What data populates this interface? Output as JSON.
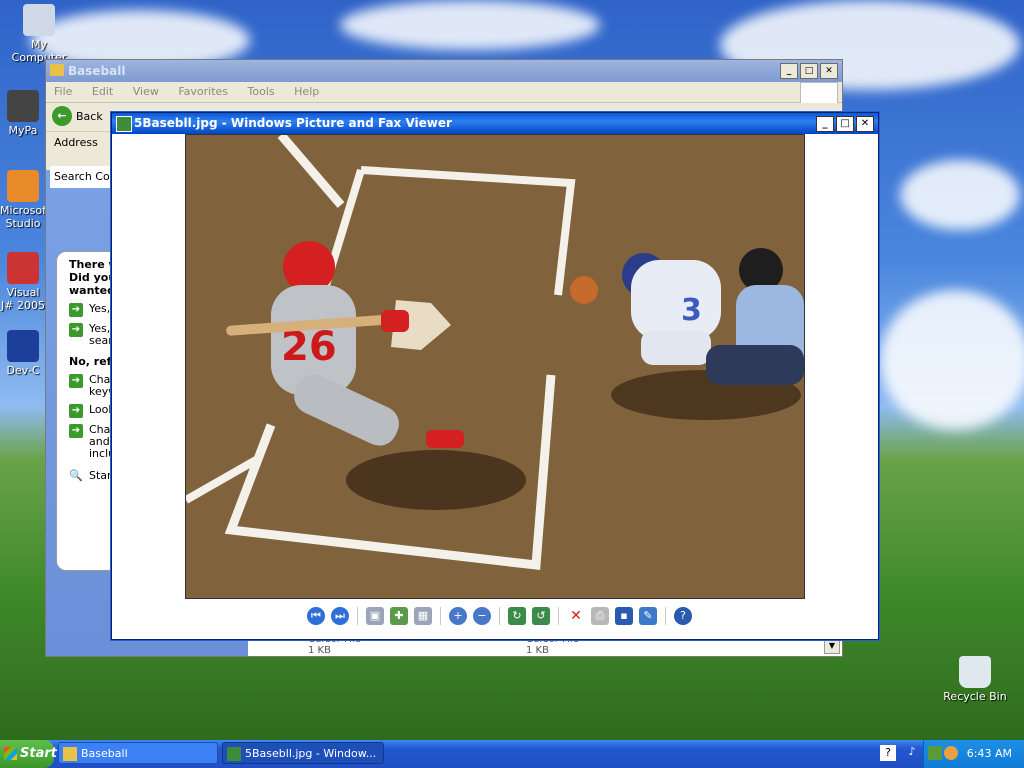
{
  "desktop": {
    "icons": [
      {
        "label": "My Computer"
      },
      {
        "label": "MyPa"
      },
      {
        "label": "Microsoft Studio"
      },
      {
        "label": "Visual J# 2005"
      },
      {
        "label": "Dev-C"
      },
      {
        "label": "Recycle Bin"
      }
    ]
  },
  "explorer": {
    "title": "Baseball",
    "menu": [
      "File",
      "Edit",
      "View",
      "Favorites",
      "Tools",
      "Help"
    ],
    "back_label": "Back",
    "address_label": "Address",
    "search_label": "Search Com",
    "assistant": {
      "question": "There w\nDid you\nwanted",
      "options_yes": [
        "Yes,",
        "Yes,\nsear"
      ],
      "refine_label": "No, refi",
      "options_refine": [
        "Cha\nkeyw",
        "Look",
        "Cha\nand\ninclu"
      ],
      "start_label": "Star"
    },
    "status_items": [
      {
        "label": "Cursor File",
        "size": "1 KB"
      },
      {
        "label": "Cursor File",
        "size": "1 KB"
      }
    ]
  },
  "viewer": {
    "title": "5Basebll.jpg - Windows Picture and Fax Viewer",
    "toolbar_icons": [
      "previous-image-icon",
      "next-image-icon",
      "best-fit-icon",
      "actual-size-icon",
      "slideshow-icon",
      "zoom-in-icon",
      "zoom-out-icon",
      "rotate-clockwise-icon",
      "rotate-counterclockwise-icon",
      "delete-icon",
      "print-icon",
      "save-icon",
      "edit-icon",
      "help-icon"
    ]
  },
  "taskbar": {
    "start_label": "Start",
    "tasks": [
      {
        "label": "Baseball"
      },
      {
        "label": "5Basebll.jpg - Window..."
      }
    ],
    "clock": "6:43 AM"
  },
  "colors": {
    "titlebar_active": "#0a58d8",
    "taskbar": "#2458d0",
    "start_green": "#3a962c"
  }
}
